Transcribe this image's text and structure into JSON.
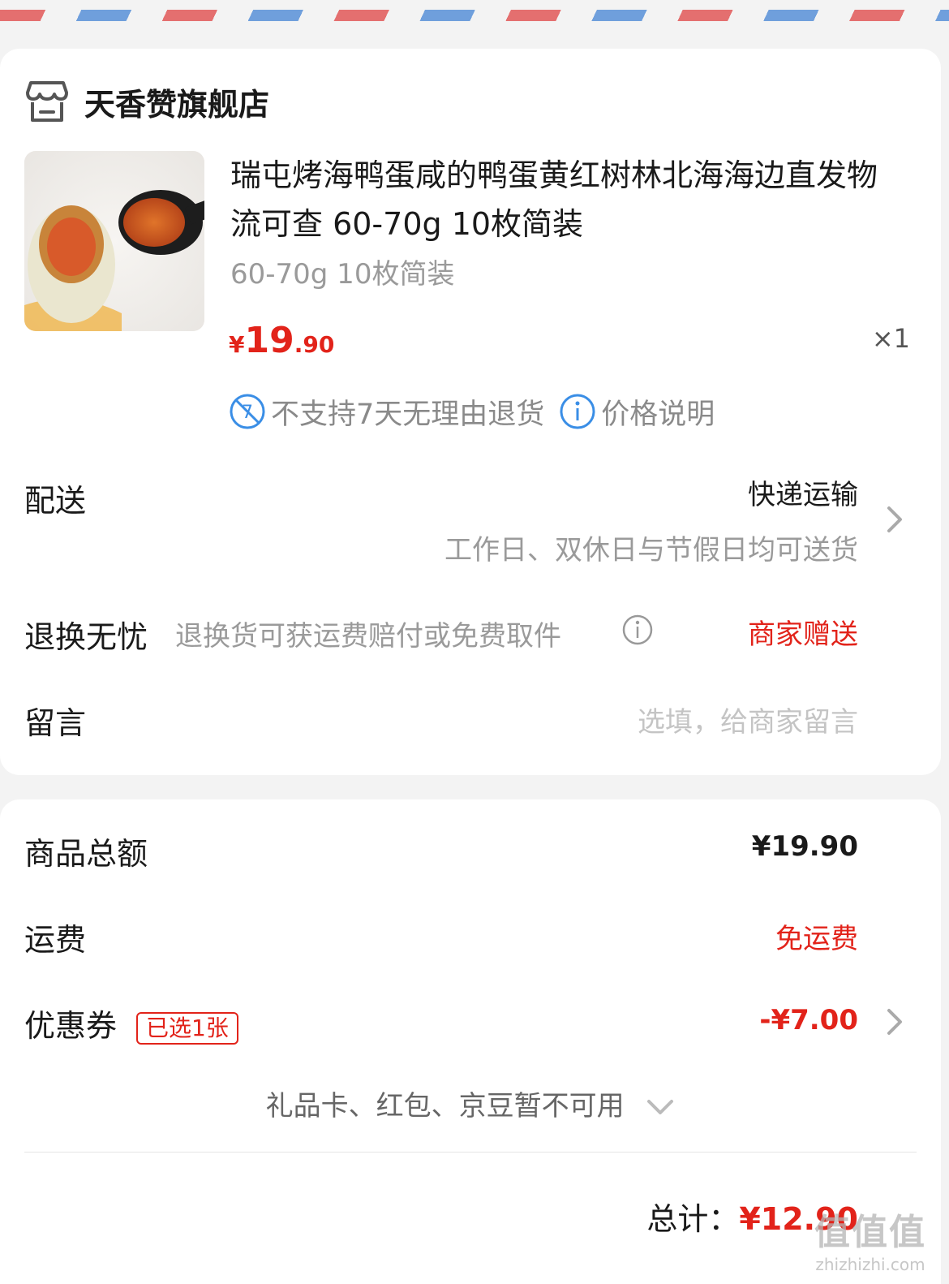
{
  "store": {
    "name": "天香赞旗舰店",
    "icon": "store-icon"
  },
  "product": {
    "title": "瑞屯烤海鸭蛋咸的鸭蛋黄红树林北海海边直发物流可查 60-70g 10枚简装",
    "spec": "60-70g 10枚简装",
    "price_symbol": "¥",
    "price_int": "19",
    "price_dec": ".90",
    "quantity": "×1",
    "policy_no_return": "不支持7天无理由退货",
    "policy_price_note": "价格说明"
  },
  "delivery": {
    "label": "配送",
    "method": "快递运输",
    "note": "工作日、双休日与节假日均可送货"
  },
  "return_worry": {
    "label": "退换无忧",
    "desc": "退换货可获运费赔付或免费取件",
    "value": "商家赠送"
  },
  "message": {
    "label": "留言",
    "placeholder": "选填，给商家留言"
  },
  "summary": {
    "goods_total_label": "商品总额",
    "goods_total_value": "¥19.90",
    "shipping_label": "运费",
    "shipping_value": "免运费",
    "coupon_label": "优惠券",
    "coupon_badge": "已选1张",
    "coupon_value": "-¥7.00",
    "unavailable_note": "礼品卡、红包、京豆暂不可用",
    "total_label": "总计：",
    "total_value": "¥12.90"
  },
  "watermark": {
    "logo": "值值值",
    "url": "zhizhizhi.com"
  },
  "colors": {
    "accent_red": "#e2231a",
    "info_blue": "#3a8ee6",
    "muted_gray": "#9a9a9a"
  }
}
